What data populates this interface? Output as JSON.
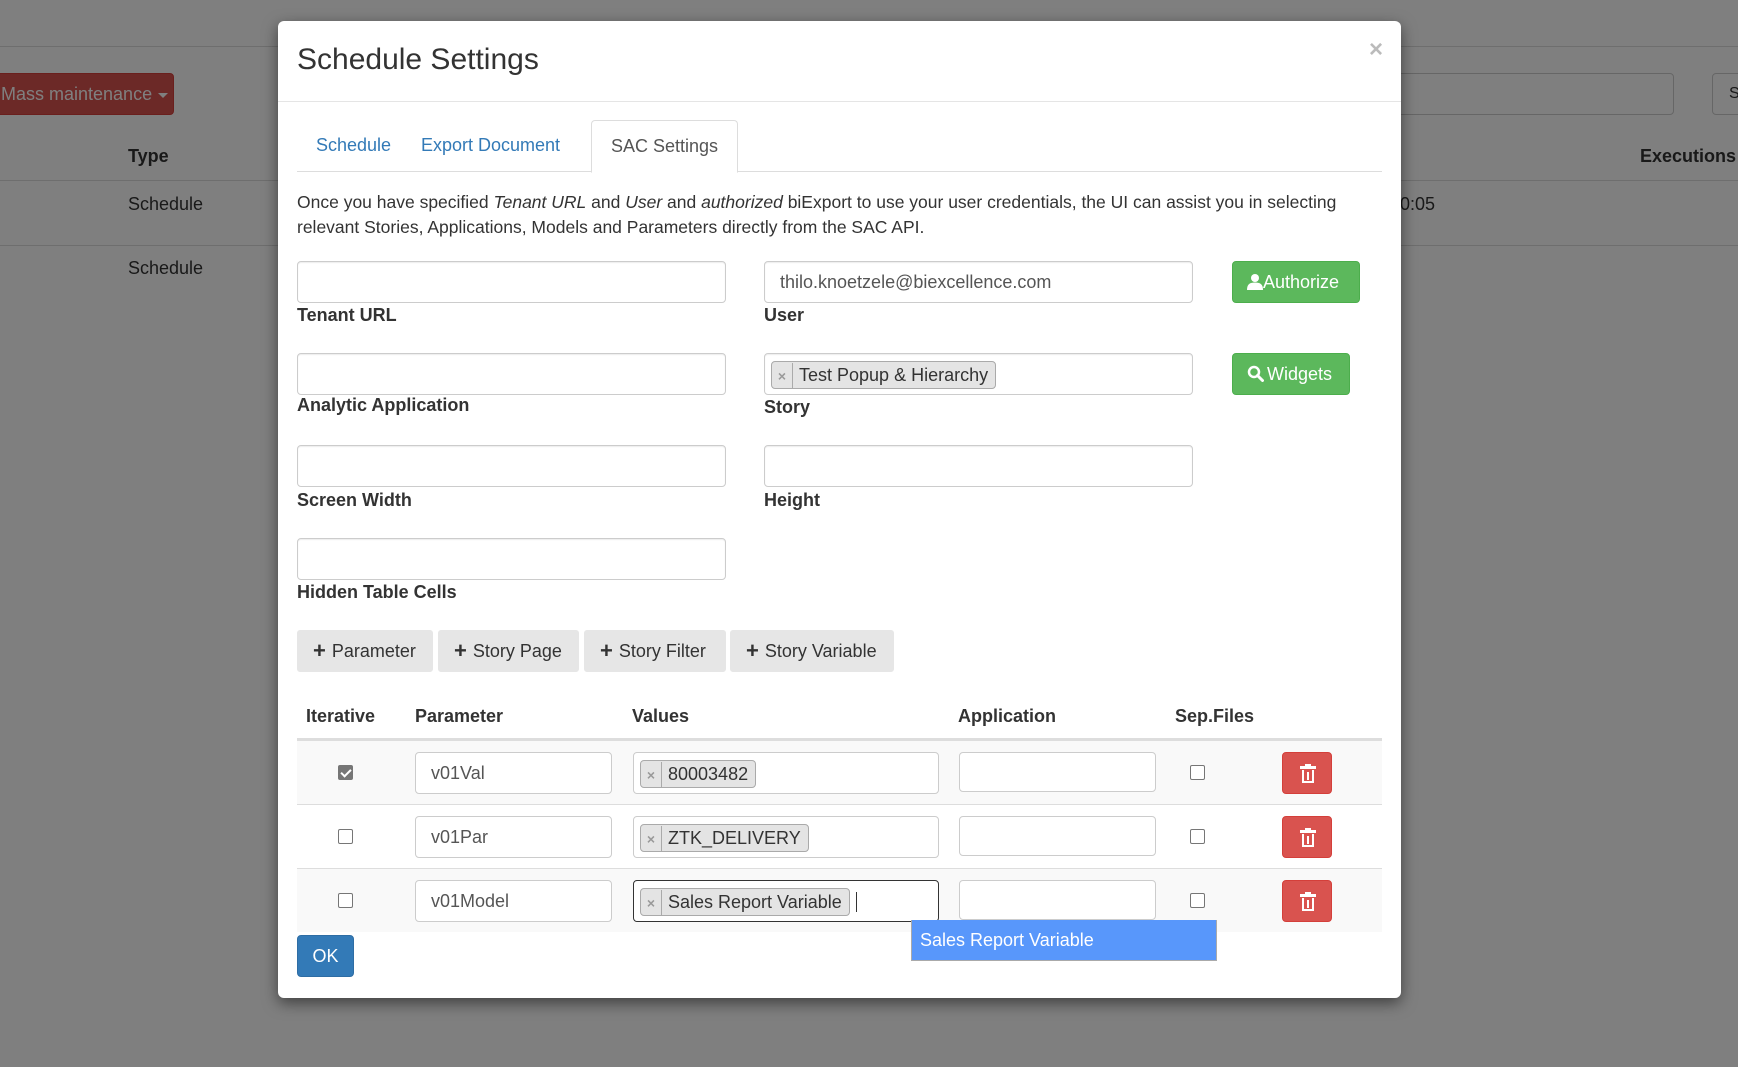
{
  "background": {
    "mass_button_label": "Mass maintenance",
    "search_button_label": "S",
    "table": {
      "headers": {
        "type": "Type",
        "executions": "Executions"
      },
      "rows": [
        {
          "type": "Schedule",
          "time_fragment": "0:05"
        },
        {
          "type": "Schedule"
        }
      ]
    }
  },
  "modal": {
    "title": "Schedule Settings",
    "close_symbol": "×",
    "tabs": [
      {
        "label": "Schedule",
        "active": false
      },
      {
        "label": "Export Document",
        "active": false
      },
      {
        "label": "SAC Settings",
        "active": true
      }
    ],
    "intro": {
      "t1": "Once you have specified ",
      "tenant_url": "Tenant URL",
      "t2": " and ",
      "user": "User",
      "t3": " and ",
      "authorized": "authorized",
      "t4": " biExport to use your user credentials, the UI can assist you in selecting relevant Stories, Applications, Models and Parameters directly from the SAC API."
    },
    "fields": {
      "tenant_url": {
        "label": "Tenant URL",
        "value": ""
      },
      "user": {
        "label": "User",
        "value": "thilo.knoetzele@biexcellence.com"
      },
      "analytic_application": {
        "label": "Analytic Application",
        "value": ""
      },
      "story": {
        "label": "Story",
        "tag": "Test Popup & Hierarchy"
      },
      "screen_width": {
        "label": "Screen Width",
        "value": ""
      },
      "height": {
        "label": "Height",
        "value": ""
      },
      "hidden_table_cells": {
        "label": "Hidden Table Cells",
        "value": ""
      }
    },
    "buttons": {
      "authorize": "Authorize",
      "widgets": "Widgets",
      "add_parameter": "Parameter",
      "add_story_page": "Story Page",
      "add_story_filter": "Story Filter",
      "add_story_variable": "Story Variable",
      "ok": "OK"
    },
    "tag_remove_symbol": "×",
    "param_table": {
      "headers": {
        "iterative": "Iterative",
        "parameter": "Parameter",
        "values": "Values",
        "application": "Application",
        "sep_files": "Sep.Files"
      },
      "rows": [
        {
          "iterative": true,
          "parameter": "v01Val",
          "value_tag": "80003482",
          "application": "",
          "sep_files": false
        },
        {
          "iterative": false,
          "parameter": "v01Par",
          "value_tag": "ZTK_DELIVERY",
          "application": "",
          "sep_files": false
        },
        {
          "iterative": false,
          "parameter": "v01Model",
          "value_tag": "Sales Report Variable",
          "application": "",
          "sep_files": false
        }
      ]
    },
    "dropdown": {
      "option": "Sales Report Variable"
    }
  },
  "colors": {
    "primary": "#337ab7",
    "success": "#5cb85c",
    "danger": "#d9534f",
    "highlight": "#5897fb"
  }
}
